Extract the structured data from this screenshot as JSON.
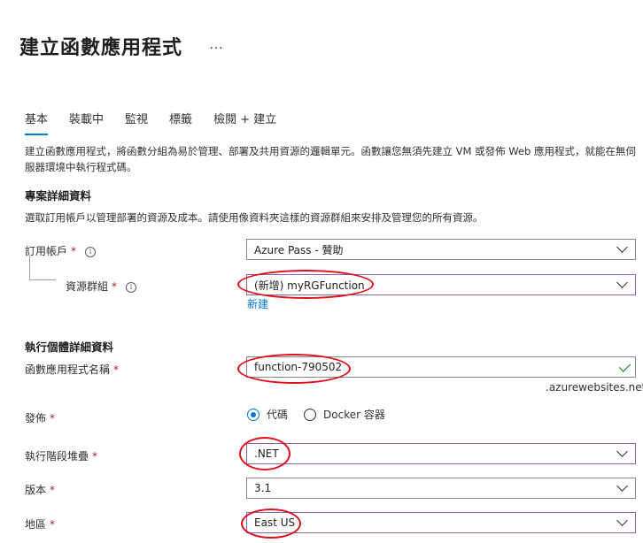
{
  "header": {
    "title": "建立函數應用程式",
    "more": "…"
  },
  "tabs": [
    "基本",
    "裝載中",
    "監視",
    "標籤",
    "檢閱 + 建立"
  ],
  "description": "建立函數應用程式，將函數分組為易於管理、部署及共用資源的邏輯單元。函數讓您無須先建立 VM 或發佈 Web 應用程式，就能在無伺服器環境中執行程式碼。",
  "project": {
    "heading": "專案詳細資料",
    "subtext": "選取訂用帳戶以管理部署的資源及成本。請使用像資料夾這樣的資源群組來安排及管理您的所有資源。",
    "subscription_label": "訂用帳戶",
    "subscription_value": "Azure Pass - 贊助",
    "resource_group_label": "資源群組",
    "resource_group_value": "(新增) myRGFunction",
    "create_new_link": "新建"
  },
  "instance": {
    "heading": "執行個體詳細資料",
    "name_label": "函數應用程式名稱",
    "name_value": "function-790502",
    "domain_suffix": ".azurewebsites.net",
    "publish_label": "發佈",
    "publish_options": [
      "代碼",
      "Docker 容器"
    ],
    "runtime_label": "執行階段堆疊",
    "runtime_value": ".NET",
    "version_label": "版本",
    "version_value": "3.1",
    "region_label": "地區",
    "region_value": "East US"
  },
  "required_marker": "*",
  "info_glyph": "i",
  "colors": {
    "accent": "#0078d4",
    "annotation": "#e0101b",
    "required": "#a4262c",
    "valid": "#107c10"
  }
}
